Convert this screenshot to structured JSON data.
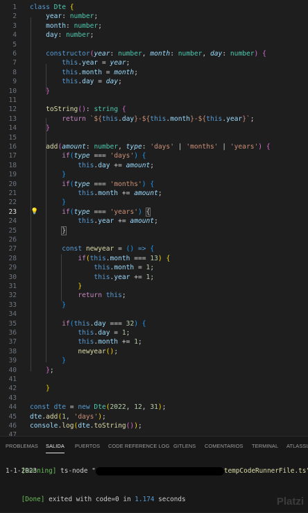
{
  "editor": {
    "lines": [
      {
        "n": "1",
        "t": [
          [
            "kb",
            "class "
          ],
          [
            "cl",
            "Dte "
          ],
          [
            "b1",
            "{"
          ]
        ]
      },
      {
        "n": "2",
        "t": [
          [
            "pu",
            "    "
          ],
          [
            "pr",
            "year"
          ],
          [
            "pu",
            ": "
          ],
          [
            "cl",
            "number"
          ],
          [
            "pu",
            ";"
          ]
        ]
      },
      {
        "n": "3",
        "t": [
          [
            "pu",
            "    "
          ],
          [
            "pr",
            "month"
          ],
          [
            "pu",
            ": "
          ],
          [
            "cl",
            "number"
          ],
          [
            "pu",
            ";"
          ]
        ]
      },
      {
        "n": "4",
        "t": [
          [
            "pu",
            "    "
          ],
          [
            "pr",
            "day"
          ],
          [
            "pu",
            ": "
          ],
          [
            "cl",
            "number"
          ],
          [
            "pu",
            ";"
          ]
        ]
      },
      {
        "n": "5",
        "t": []
      },
      {
        "n": "6",
        "t": [
          [
            "pu",
            "    "
          ],
          [
            "kb",
            "constructor"
          ],
          [
            "b2",
            "("
          ],
          [
            "pa",
            "year"
          ],
          [
            "pu",
            ": "
          ],
          [
            "cl",
            "number"
          ],
          [
            "pu",
            ", "
          ],
          [
            "pa",
            "month"
          ],
          [
            "pu",
            ": "
          ],
          [
            "cl",
            "number"
          ],
          [
            "pu",
            ", "
          ],
          [
            "pa",
            "day"
          ],
          [
            "pu",
            ": "
          ],
          [
            "cl",
            "number"
          ],
          [
            "b2",
            ")"
          ],
          [
            "pu",
            " "
          ],
          [
            "b2",
            "{"
          ]
        ]
      },
      {
        "n": "7",
        "t": [
          [
            "pu",
            "        "
          ],
          [
            "th",
            "this"
          ],
          [
            "pu",
            "."
          ],
          [
            "pr",
            "year"
          ],
          [
            "pu",
            " = "
          ],
          [
            "pa",
            "year"
          ],
          [
            "pu",
            ";"
          ]
        ]
      },
      {
        "n": "8",
        "t": [
          [
            "pu",
            "        "
          ],
          [
            "th",
            "this"
          ],
          [
            "pu",
            "."
          ],
          [
            "pr",
            "month"
          ],
          [
            "pu",
            " = "
          ],
          [
            "pa",
            "month"
          ],
          [
            "pu",
            ";"
          ]
        ]
      },
      {
        "n": "9",
        "t": [
          [
            "pu",
            "        "
          ],
          [
            "th",
            "this"
          ],
          [
            "pu",
            "."
          ],
          [
            "pr",
            "day"
          ],
          [
            "pu",
            " = "
          ],
          [
            "pa",
            "day"
          ],
          [
            "pu",
            ";"
          ]
        ]
      },
      {
        "n": "10",
        "t": [
          [
            "pu",
            "    "
          ],
          [
            "b2",
            "}"
          ]
        ]
      },
      {
        "n": "11",
        "t": []
      },
      {
        "n": "12",
        "t": [
          [
            "pu",
            "    "
          ],
          [
            "fn",
            "toString"
          ],
          [
            "b2",
            "()"
          ],
          [
            "pu",
            ": "
          ],
          [
            "cl",
            "string"
          ],
          [
            "pu",
            " "
          ],
          [
            "b2",
            "{"
          ]
        ]
      },
      {
        "n": "13",
        "t": [
          [
            "pu",
            "        "
          ],
          [
            "kw",
            "return "
          ],
          [
            "st",
            "`${"
          ],
          [
            "th",
            "this"
          ],
          [
            "pu",
            "."
          ],
          [
            "pr",
            "day"
          ],
          [
            "st",
            "}-${"
          ],
          [
            "th",
            "this"
          ],
          [
            "pu",
            "."
          ],
          [
            "pr",
            "month"
          ],
          [
            "st",
            "}-${"
          ],
          [
            "th",
            "this"
          ],
          [
            "pu",
            "."
          ],
          [
            "pr",
            "year"
          ],
          [
            "st",
            "}`"
          ],
          [
            "pu",
            ";"
          ]
        ]
      },
      {
        "n": "14",
        "t": [
          [
            "pu",
            "    "
          ],
          [
            "b2",
            "}"
          ]
        ]
      },
      {
        "n": "15",
        "t": []
      },
      {
        "n": "16",
        "t": [
          [
            "pu",
            "    "
          ],
          [
            "fn",
            "add"
          ],
          [
            "b2",
            "("
          ],
          [
            "pa",
            "amount"
          ],
          [
            "pu",
            ": "
          ],
          [
            "cl",
            "number"
          ],
          [
            "pu",
            ", "
          ],
          [
            "pa",
            "type"
          ],
          [
            "pu",
            ": "
          ],
          [
            "st",
            "'days'"
          ],
          [
            "pu",
            " | "
          ],
          [
            "st",
            "'months'"
          ],
          [
            "pu",
            " | "
          ],
          [
            "st",
            "'years'"
          ],
          [
            "b2",
            ")"
          ],
          [
            "pu",
            " "
          ],
          [
            "b2",
            "{"
          ]
        ]
      },
      {
        "n": "17",
        "t": [
          [
            "pu",
            "        "
          ],
          [
            "kw",
            "if"
          ],
          [
            "b3",
            "("
          ],
          [
            "pa",
            "type"
          ],
          [
            "pu",
            " === "
          ],
          [
            "st",
            "'days'"
          ],
          [
            "b3",
            ")"
          ],
          [
            "pu",
            " "
          ],
          [
            "b3",
            "{"
          ]
        ]
      },
      {
        "n": "18",
        "t": [
          [
            "pu",
            "            "
          ],
          [
            "th",
            "this"
          ],
          [
            "pu",
            "."
          ],
          [
            "pr",
            "day"
          ],
          [
            "pu",
            " += "
          ],
          [
            "pa",
            "amount"
          ],
          [
            "pu",
            ";"
          ]
        ]
      },
      {
        "n": "19",
        "t": [
          [
            "pu",
            "        "
          ],
          [
            "b3",
            "}"
          ]
        ]
      },
      {
        "n": "20",
        "t": [
          [
            "pu",
            "        "
          ],
          [
            "kw",
            "if"
          ],
          [
            "b3",
            "("
          ],
          [
            "pa",
            "type"
          ],
          [
            "pu",
            " === "
          ],
          [
            "st",
            "'months'"
          ],
          [
            "b3",
            ")"
          ],
          [
            "pu",
            " "
          ],
          [
            "b3",
            "{"
          ]
        ]
      },
      {
        "n": "21",
        "t": [
          [
            "pu",
            "            "
          ],
          [
            "th",
            "this"
          ],
          [
            "pu",
            "."
          ],
          [
            "pr",
            "month"
          ],
          [
            "pu",
            " += "
          ],
          [
            "pa",
            "amount"
          ],
          [
            "pu",
            ";"
          ]
        ]
      },
      {
        "n": "22",
        "t": [
          [
            "pu",
            "        "
          ],
          [
            "b3",
            "}"
          ]
        ]
      },
      {
        "n": "23",
        "t": [
          [
            "pu",
            "        "
          ],
          [
            "kw",
            "if"
          ],
          [
            "b3",
            "("
          ],
          [
            "pa",
            "type"
          ],
          [
            "pu",
            " === "
          ],
          [
            "st",
            "'years'"
          ],
          [
            "b3",
            ")"
          ],
          [
            "pu",
            " "
          ],
          [
            "bm",
            "{"
          ],
          [
            "cursor",
            ""
          ]
        ],
        "active": true,
        "bulb": true
      },
      {
        "n": "24",
        "t": [
          [
            "pu",
            "            "
          ],
          [
            "th",
            "this"
          ],
          [
            "pu",
            "."
          ],
          [
            "pr",
            "year"
          ],
          [
            "pu",
            " += "
          ],
          [
            "pa",
            "amount"
          ],
          [
            "pu",
            ";"
          ]
        ]
      },
      {
        "n": "25",
        "t": [
          [
            "pu",
            "        "
          ],
          [
            "bm",
            "}"
          ]
        ]
      },
      {
        "n": "26",
        "t": []
      },
      {
        "n": "27",
        "t": [
          [
            "pu",
            "        "
          ],
          [
            "kb",
            "const "
          ],
          [
            "fn",
            "newyear"
          ],
          [
            "pu",
            " = "
          ],
          [
            "b3",
            "()"
          ],
          [
            "pu",
            " "
          ],
          [
            "kb",
            "=>"
          ],
          [
            "pu",
            " "
          ],
          [
            "b3",
            "{"
          ]
        ]
      },
      {
        "n": "28",
        "t": [
          [
            "pu",
            "            "
          ],
          [
            "kw",
            "if"
          ],
          [
            "b1",
            "("
          ],
          [
            "th",
            "this"
          ],
          [
            "pu",
            "."
          ],
          [
            "pr",
            "month"
          ],
          [
            "pu",
            " === "
          ],
          [
            "nu",
            "13"
          ],
          [
            "b1",
            ")"
          ],
          [
            "pu",
            " "
          ],
          [
            "b1",
            "{"
          ]
        ]
      },
      {
        "n": "29",
        "t": [
          [
            "pu",
            "                "
          ],
          [
            "th",
            "this"
          ],
          [
            "pu",
            "."
          ],
          [
            "pr",
            "month"
          ],
          [
            "pu",
            " = "
          ],
          [
            "nu",
            "1"
          ],
          [
            "pu",
            ";"
          ]
        ]
      },
      {
        "n": "30",
        "t": [
          [
            "pu",
            "                "
          ],
          [
            "th",
            "this"
          ],
          [
            "pu",
            "."
          ],
          [
            "pr",
            "year"
          ],
          [
            "pu",
            " += "
          ],
          [
            "nu",
            "1"
          ],
          [
            "pu",
            ";"
          ]
        ]
      },
      {
        "n": "31",
        "t": [
          [
            "pu",
            "            "
          ],
          [
            "b1",
            "}"
          ]
        ]
      },
      {
        "n": "32",
        "t": [
          [
            "pu",
            "            "
          ],
          [
            "kw",
            "return "
          ],
          [
            "th",
            "this"
          ],
          [
            "pu",
            ";"
          ]
        ]
      },
      {
        "n": "33",
        "t": [
          [
            "pu",
            "        "
          ],
          [
            "b3",
            "}"
          ]
        ]
      },
      {
        "n": "34",
        "t": []
      },
      {
        "n": "35",
        "t": [
          [
            "pu",
            "        "
          ],
          [
            "kw",
            "if"
          ],
          [
            "b3",
            "("
          ],
          [
            "th",
            "this"
          ],
          [
            "pu",
            "."
          ],
          [
            "pr",
            "day"
          ],
          [
            "pu",
            " === "
          ],
          [
            "nu",
            "32"
          ],
          [
            "b3",
            ")"
          ],
          [
            "pu",
            " "
          ],
          [
            "b3",
            "{"
          ]
        ]
      },
      {
        "n": "36",
        "t": [
          [
            "pu",
            "            "
          ],
          [
            "th",
            "this"
          ],
          [
            "pu",
            "."
          ],
          [
            "pr",
            "day"
          ],
          [
            "pu",
            " = "
          ],
          [
            "nu",
            "1"
          ],
          [
            "pu",
            ";"
          ]
        ]
      },
      {
        "n": "37",
        "t": [
          [
            "pu",
            "            "
          ],
          [
            "th",
            "this"
          ],
          [
            "pu",
            "."
          ],
          [
            "pr",
            "month"
          ],
          [
            "pu",
            " += "
          ],
          [
            "nu",
            "1"
          ],
          [
            "pu",
            ";"
          ]
        ]
      },
      {
        "n": "38",
        "t": [
          [
            "pu",
            "            "
          ],
          [
            "fn",
            "newyear"
          ],
          [
            "b1",
            "()"
          ],
          [
            "pu",
            ";"
          ]
        ]
      },
      {
        "n": "39",
        "t": [
          [
            "pu",
            "        "
          ],
          [
            "b3",
            "}"
          ]
        ]
      },
      {
        "n": "40",
        "t": [
          [
            "pu",
            "    "
          ],
          [
            "b2",
            "}"
          ],
          [
            "pu",
            ";"
          ]
        ]
      },
      {
        "n": "41",
        "t": []
      },
      {
        "n": "42",
        "t": [
          [
            "pu",
            "    "
          ],
          [
            "b1",
            "}"
          ]
        ]
      },
      {
        "n": "43",
        "t": []
      },
      {
        "n": "44",
        "t": [
          [
            "kb",
            "const "
          ],
          [
            "th",
            "dte"
          ],
          [
            "pu",
            " = "
          ],
          [
            "kb",
            "new "
          ],
          [
            "cl",
            "Dte"
          ],
          [
            "b1",
            "("
          ],
          [
            "nu",
            "2022"
          ],
          [
            "pu",
            ", "
          ],
          [
            "nu",
            "12"
          ],
          [
            "pu",
            ", "
          ],
          [
            "nu",
            "31"
          ],
          [
            "b1",
            ")"
          ],
          [
            "pu",
            ";"
          ]
        ]
      },
      {
        "n": "45",
        "t": [
          [
            "pr",
            "dte"
          ],
          [
            "pu",
            "."
          ],
          [
            "fn",
            "add"
          ],
          [
            "b1",
            "("
          ],
          [
            "nu",
            "1"
          ],
          [
            "pu",
            ", "
          ],
          [
            "st",
            "'days'"
          ],
          [
            "b1",
            ")"
          ],
          [
            "pu",
            ";"
          ]
        ]
      },
      {
        "n": "46",
        "t": [
          [
            "pr",
            "console"
          ],
          [
            "pu",
            "."
          ],
          [
            "fn",
            "log"
          ],
          [
            "b1",
            "("
          ],
          [
            "pr",
            "dte"
          ],
          [
            "pu",
            "."
          ],
          [
            "fn",
            "toString"
          ],
          [
            "b2",
            "()"
          ],
          [
            "b1",
            ")"
          ],
          [
            "pu",
            ";"
          ]
        ]
      },
      {
        "n": "47",
        "t": []
      }
    ]
  },
  "panel": {
    "tabs": [
      {
        "label": "PROBLEMAS"
      },
      {
        "label": "SALIDA",
        "active": true
      },
      {
        "label": "PUERTOS"
      },
      {
        "label": "CODE REFERENCE LOG"
      },
      {
        "label": "GITLENS"
      },
      {
        "label": "COMENTARIOS"
      },
      {
        "label": "TERMINAL"
      },
      {
        "label": "ATLASSIAN"
      }
    ],
    "output": {
      "running_tag": "[Running]",
      "running_cmd": "ts-node \"",
      "running_file": "tempCodeRunnerFile.ts\"",
      "result": "1-1-2023",
      "done_tag": "[Done]",
      "done_text_1": " exited with ",
      "done_code": "code=0",
      "done_text_2": " in ",
      "done_time": "1.174",
      "done_text_3": " seconds"
    },
    "watermark": "Platzi"
  }
}
